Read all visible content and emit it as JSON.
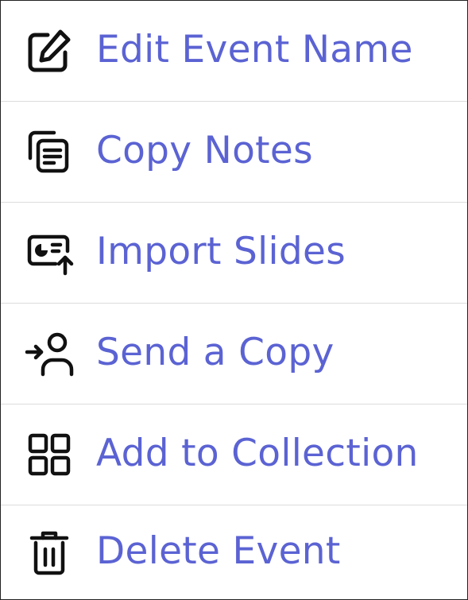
{
  "menu": {
    "items": [
      {
        "label": "Edit Event Name",
        "icon": "edit-icon"
      },
      {
        "label": "Copy Notes",
        "icon": "copy-notes-icon"
      },
      {
        "label": "Import Slides",
        "icon": "import-slides-icon"
      },
      {
        "label": "Send a Copy",
        "icon": "send-user-icon"
      },
      {
        "label": "Add to Collection",
        "icon": "grid-icon"
      },
      {
        "label": "Delete Event",
        "icon": "trash-icon"
      }
    ],
    "colors": {
      "label": "#5b63d3",
      "icon": "#111111",
      "divider": "#dcdcdc",
      "border": "#222222"
    }
  }
}
